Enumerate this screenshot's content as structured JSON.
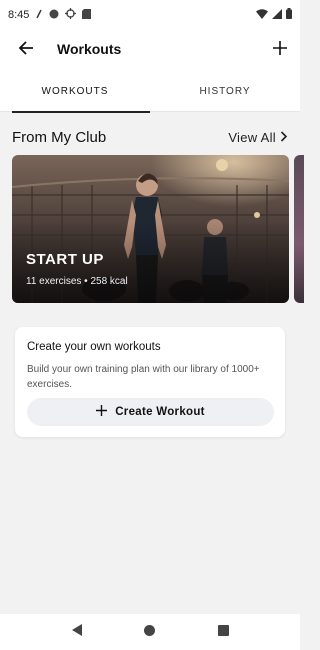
{
  "status_bar": {
    "time": "8:45",
    "icons": [
      "signal-slash-icon",
      "circle-icon",
      "crosshair-icon",
      "sd-card-icon",
      "wifi-icon",
      "cell-signal-icon",
      "battery-icon"
    ]
  },
  "header": {
    "title": "Workouts",
    "back_icon": "arrow-left-icon",
    "add_icon": "plus-icon"
  },
  "tabs": [
    {
      "label": "WORKOUTS",
      "active": true
    },
    {
      "label": "HISTORY",
      "active": false
    }
  ],
  "club_section": {
    "title": "From My Club",
    "view_all": "View All"
  },
  "workout_card": {
    "title": "START UP",
    "meta": "11 exercises • 258 kcal"
  },
  "create_card": {
    "heading": "Create your own workouts",
    "description": "Build your own training plan with our library of 1000+ exercises.",
    "button_label": "Create Workout"
  },
  "nav": {
    "icons": [
      "back-triangle-icon",
      "home-circle-icon",
      "recents-square-icon"
    ]
  },
  "colors": {
    "background": "#f2f2f2",
    "surface": "#ffffff",
    "button": "#eef0f3"
  }
}
